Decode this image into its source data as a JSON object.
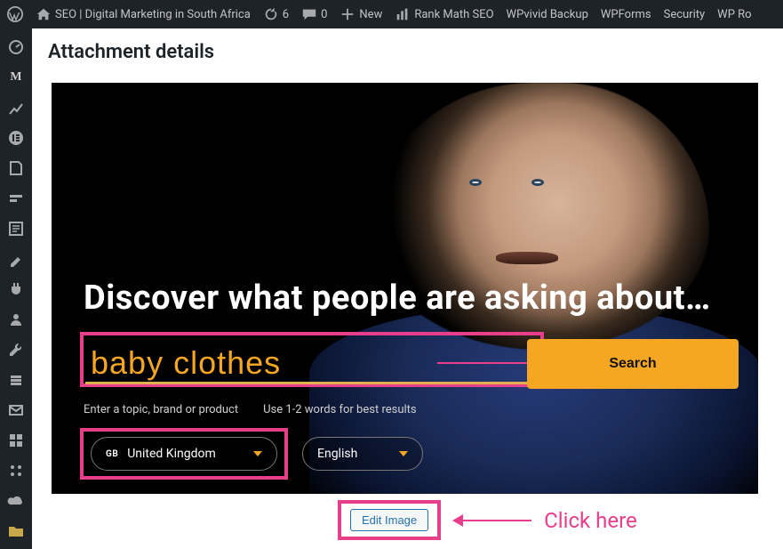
{
  "adminbar": {
    "site_title": "SEO | Digital Marketing in South Africa",
    "updates": "6",
    "comments": "0",
    "new_label": "New",
    "rankmath": "Rank Math SEO",
    "wpvivid": "WPvivid Backup",
    "wpforms": "WPForms",
    "security": "Security",
    "wprocket": "WP Ro"
  },
  "panel": {
    "title": "Attachment details",
    "edit_image": "Edit Image",
    "click_here": "Click here"
  },
  "hero": {
    "headline": "Discover what people are asking about…",
    "search_value": "baby clothes",
    "hint_left": "Enter a topic, brand or product",
    "hint_right": "Use 1-2 words for best results",
    "search_btn": "Search",
    "region_cc": "GB",
    "region_name": "United Kingdom",
    "language": "English"
  },
  "rail": {
    "m_label": "M"
  }
}
